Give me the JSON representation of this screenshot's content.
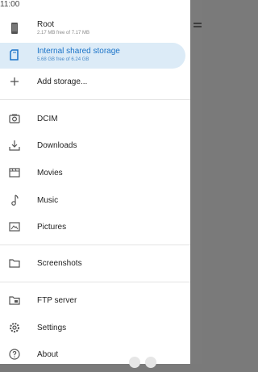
{
  "status": {
    "time": "11:00"
  },
  "storage": [
    {
      "name": "Root",
      "detail": "2.17 MB free of 7.17 MB",
      "icon": "phone-icon",
      "selected": false
    },
    {
      "name": "Internal shared storage",
      "detail": "5.68 GB free of 6.24 GB",
      "icon": "sd-card-icon",
      "selected": true
    }
  ],
  "add_storage": {
    "label": "Add storage...",
    "icon": "plus-icon"
  },
  "folders": [
    {
      "label": "DCIM",
      "icon": "camera-icon"
    },
    {
      "label": "Downloads",
      "icon": "download-icon"
    },
    {
      "label": "Movies",
      "icon": "movie-icon"
    },
    {
      "label": "Music",
      "icon": "music-note-icon"
    },
    {
      "label": "Pictures",
      "icon": "image-icon"
    }
  ],
  "screenshots": {
    "label": "Screenshots",
    "icon": "folder-icon"
  },
  "footer": [
    {
      "label": "FTP server",
      "icon": "ftp-server-icon"
    },
    {
      "label": "Settings",
      "icon": "gear-icon"
    },
    {
      "label": "About",
      "icon": "help-icon"
    }
  ],
  "colors": {
    "accent": "#1a73c8",
    "selected_bg": "#dcebf7",
    "scrim": "#7a7a7a"
  }
}
